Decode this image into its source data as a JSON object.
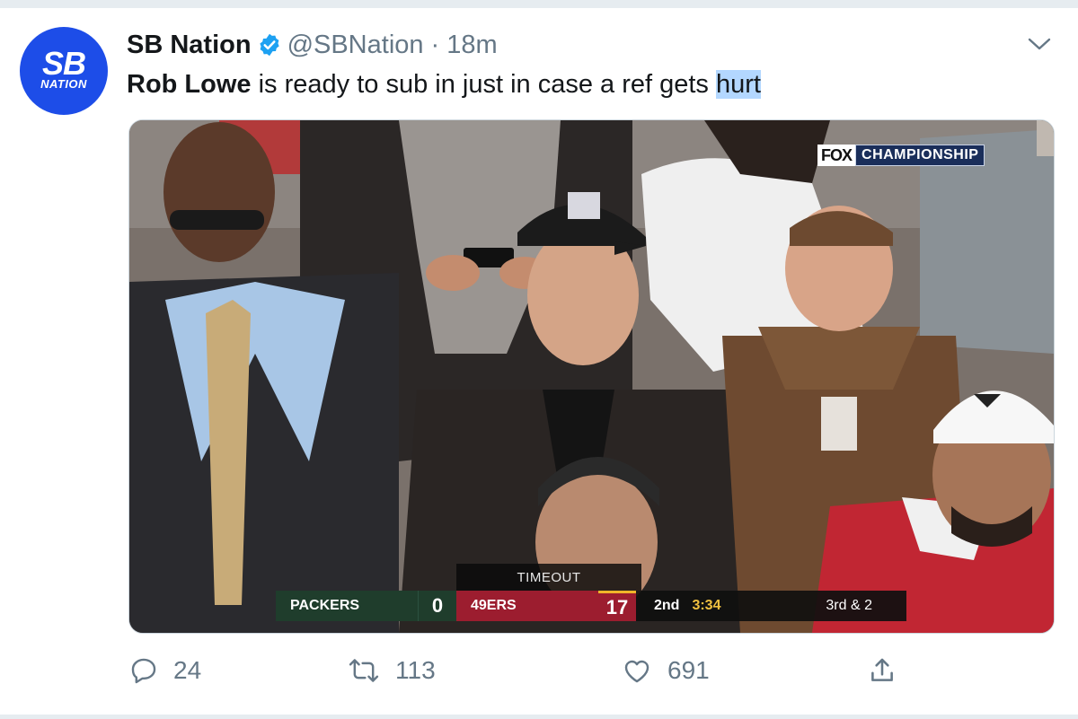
{
  "tweet": {
    "author_name": "SB Nation",
    "handle": "@SBNation",
    "separator": "·",
    "time": "18m",
    "text_bold": "Rob Lowe",
    "text_main": " is ready to sub in just in case a ref gets ",
    "text_highlighted": "hurt"
  },
  "avatar": {
    "line1": "SB",
    "line2": "NATION",
    "bg": "#1d4de8"
  },
  "media": {
    "network_logo": "FOX",
    "network_title": "CHAMPIONSHIP",
    "timeout_label": "TIMEOUT",
    "scorebug": {
      "team1": "PACKERS",
      "score1": "0",
      "team2": "49ERS",
      "score2": "17",
      "quarter": "2nd",
      "clock": "3:34",
      "down": "3rd & 2"
    }
  },
  "actions": {
    "replies": "24",
    "retweets": "113",
    "likes": "691"
  },
  "colors": {
    "verified_blue": "#1da1f2",
    "muted_text": "#657786",
    "packers_green": "#1f3d2c",
    "niners_red": "#9c1d2f"
  },
  "icons": [
    "verified-badge-icon",
    "chevron-down-icon",
    "reply-icon",
    "retweet-icon",
    "like-icon",
    "share-icon",
    "nfl-logo-icon"
  ]
}
